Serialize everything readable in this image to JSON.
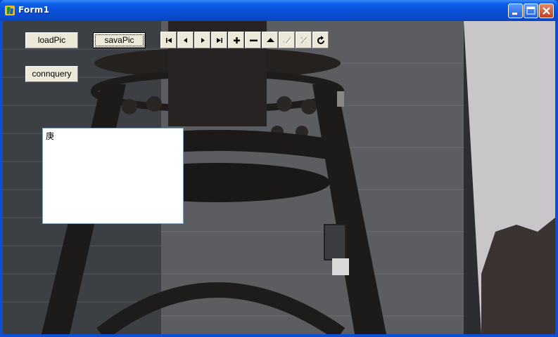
{
  "window": {
    "title": "Form1"
  },
  "buttons": {
    "load": "loadPic",
    "save": "savaPic",
    "query": "connquery"
  },
  "navigator": {
    "buttons": [
      {
        "name": "first-record-button",
        "icon": "first-icon",
        "enabled": true
      },
      {
        "name": "prior-record-button",
        "icon": "prior-icon",
        "enabled": true
      },
      {
        "name": "next-record-button",
        "icon": "next-icon",
        "enabled": true
      },
      {
        "name": "last-record-button",
        "icon": "last-icon",
        "enabled": true
      },
      {
        "name": "insert-record-button",
        "icon": "plus-icon",
        "enabled": true
      },
      {
        "name": "delete-record-button",
        "icon": "minus-icon",
        "enabled": true
      },
      {
        "name": "edit-record-button",
        "icon": "edit-icon",
        "enabled": true
      },
      {
        "name": "post-record-button",
        "icon": "check-icon",
        "enabled": false
      },
      {
        "name": "cancel-record-button",
        "icon": "x-icon",
        "enabled": false
      },
      {
        "name": "refresh-record-button",
        "icon": "refresh-icon",
        "enabled": true
      }
    ]
  },
  "memo": {
    "text": "庚"
  },
  "colors": {
    "title_bar": "#0a4fd6",
    "button_face": "#ece9d8",
    "close_button": "#c3401c"
  }
}
